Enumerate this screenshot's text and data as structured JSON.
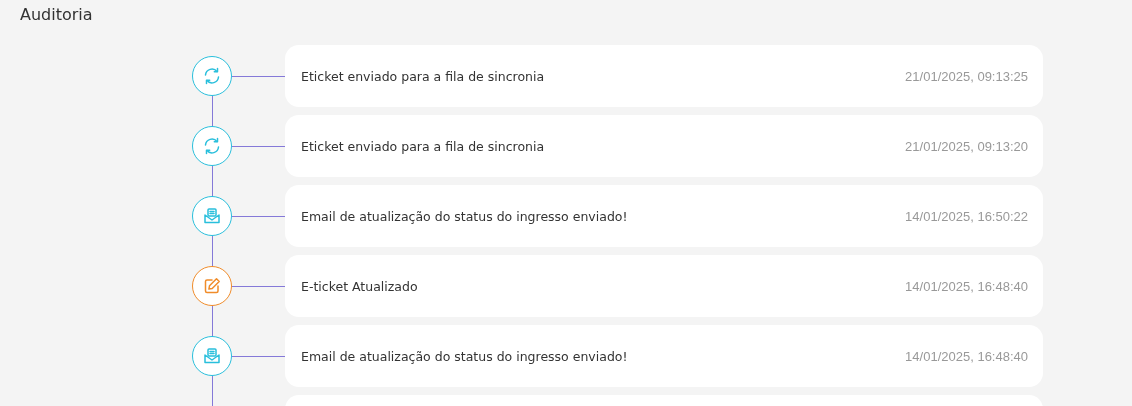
{
  "title": "Auditoria",
  "events": [
    {
      "kind": "sync",
      "color": "#29bfdc",
      "text": "Eticket enviado para a fila de sincronia",
      "time": "21/01/2025, 09:13:25"
    },
    {
      "kind": "sync",
      "color": "#29bfdc",
      "text": "Eticket enviado para a fila de sincronia",
      "time": "21/01/2025, 09:13:20"
    },
    {
      "kind": "email",
      "color": "#29bfdc",
      "text": "Email de atualização do status do ingresso enviado!",
      "time": "14/01/2025, 16:50:22"
    },
    {
      "kind": "edit",
      "color": "#f08c2a",
      "text": "E-ticket Atualizado",
      "time": "14/01/2025, 16:48:40"
    },
    {
      "kind": "email",
      "color": "#29bfdc",
      "text": "Email de atualização do status do ingresso enviado!",
      "time": "14/01/2025, 16:48:40"
    }
  ]
}
